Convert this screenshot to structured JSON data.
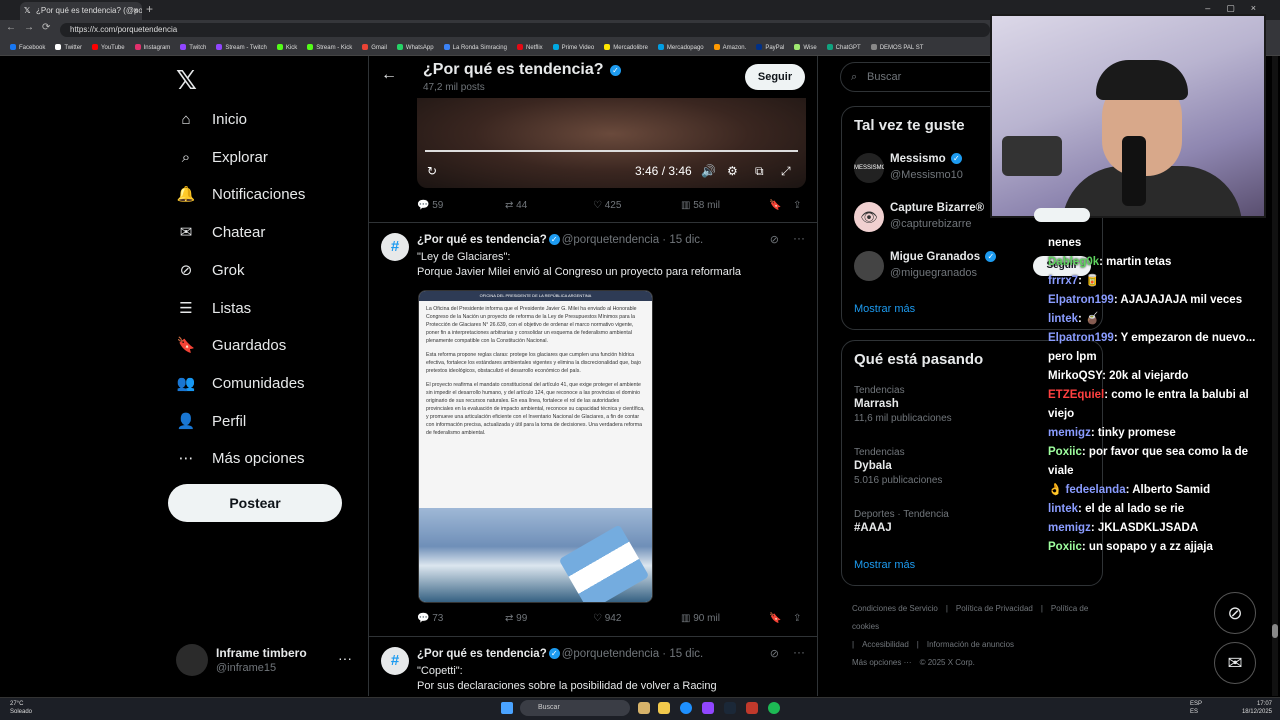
{
  "browser": {
    "tab_title": "¿Por qué es tendencia? (@porque",
    "url": "https://x.com/porquetendencia",
    "bookmarks": [
      {
        "label": "Facebook",
        "color": "#1877f2"
      },
      {
        "label": "Twitter",
        "color": "#ffffff"
      },
      {
        "label": "YouTube",
        "color": "#ff0000"
      },
      {
        "label": "Instagram",
        "color": "#e1306c"
      },
      {
        "label": "Twitch",
        "color": "#9146ff"
      },
      {
        "label": "Stream - Twitch",
        "color": "#9146ff"
      },
      {
        "label": "Kick",
        "color": "#53fc18"
      },
      {
        "label": "Stream - Kick",
        "color": "#53fc18"
      },
      {
        "label": "Gmail",
        "color": "#ea4335"
      },
      {
        "label": "WhatsApp",
        "color": "#25d366"
      },
      {
        "label": "La Ronda Simracing",
        "color": "#3b82f6"
      },
      {
        "label": "Netflix",
        "color": "#e50914"
      },
      {
        "label": "Prime Video",
        "color": "#00a8e1"
      },
      {
        "label": "Mercadolibre",
        "color": "#ffe600"
      },
      {
        "label": "Mercadopago",
        "color": "#009ee3"
      },
      {
        "label": "Amazon.",
        "color": "#ff9900"
      },
      {
        "label": "PayPal",
        "color": "#003087"
      },
      {
        "label": "Wise",
        "color": "#9fe870"
      },
      {
        "label": "ChatGPT",
        "color": "#10a37f"
      },
      {
        "label": "DEMOS PAL ST",
        "color": "#888888"
      }
    ]
  },
  "nav": {
    "logo": "𝕏",
    "items": [
      {
        "label": "Inicio",
        "icon": "home-icon",
        "glyph": "⌂"
      },
      {
        "label": "Explorar",
        "icon": "search-icon",
        "glyph": "⌕"
      },
      {
        "label": "Notificaciones",
        "icon": "bell-icon",
        "glyph": "🔔"
      },
      {
        "label": "Chatear",
        "icon": "mail-icon",
        "glyph": "✉"
      },
      {
        "label": "Grok",
        "icon": "grok-icon",
        "glyph": "⊘"
      },
      {
        "label": "Listas",
        "icon": "list-icon",
        "glyph": "☰"
      },
      {
        "label": "Guardados",
        "icon": "bookmark-icon",
        "glyph": "🔖"
      },
      {
        "label": "Comunidades",
        "icon": "communities-icon",
        "glyph": "👥"
      },
      {
        "label": "Perfil",
        "icon": "profile-icon",
        "glyph": "👤"
      },
      {
        "label": "Más opciones",
        "icon": "more-icon",
        "glyph": "⋯"
      }
    ],
    "post_label": "Postear",
    "account": {
      "name": "Inframe timbero",
      "handle": "@inframe15"
    }
  },
  "profile_header": {
    "title": "¿Por qué es tendencia?",
    "posts": "47,2 mil posts",
    "follow_label": "Seguir"
  },
  "video": {
    "time": "3:46 / 3:46"
  },
  "tweet0_metrics": {
    "replies": "59",
    "reposts": "44",
    "likes": "425",
    "views": "58 mil"
  },
  "tweets": [
    {
      "name": "¿Por qué es tendencia?",
      "handle": "@porquetendencia",
      "date": "· 15 dic.",
      "line1": "\"Ley de Glaciares\":",
      "line2": "Porque Javier Milei envió al Congreso un proyecto para reformarla",
      "metrics": {
        "replies": "73",
        "reposts": "99",
        "likes": "942",
        "views": "90 mil"
      }
    },
    {
      "name": "¿Por qué es tendencia?",
      "handle": "@porquetendencia",
      "date": "· 15 dic.",
      "line1": "\"Copetti\":",
      "line2": "Por sus declaraciones sobre la posibilidad de volver a Racing"
    }
  ],
  "doc_image": {
    "header": "OFICINA DEL PRESIDENTE DE LA REPÚBLICA ARGENTINA",
    "p1": "La Oficina del Presidente informa que el Presidente Javier G. Milei ha enviado al Honorable Congreso de la Nación un proyecto de reforma de la Ley de Presupuestos Mínimos para la Protección de Glaciares N° 26.639, con el objetivo de ordenar el marco normativo vigente, poner fin a interpretaciones arbitrarias y consolidar un esquema de federalismo ambiental plenamente compatible con la Constitución Nacional.",
    "p2": "Esta reforma propone reglas claras: protege los glaciares que cumplen una función hídrica efectiva, fortalece los estándares ambientales vigentes y elimina la discrecionalidad que, bajo pretextos ideológicos, obstaculizó el desarrollo económico del país.",
    "p3": "El proyecto reafirma el mandato constitucional del artículo 41, que exige proteger el ambiente sin impedir el desarrollo humano, y del artículo 124, que reconoce a las provincias el dominio originario de sus recursos naturales. En esa línea, fortalece el rol de las autoridades provinciales en la evaluación de impacto ambiental, reconoce su capacidad técnica y científica, y promueve una articulación eficiente con el Inventario Nacional de Glaciares, a fin de contar con información precisa, actualizada y útil para la toma de decisiones. Una verdadera reforma de federalismo ambiental."
  },
  "right": {
    "search_placeholder": "Buscar",
    "suggest_title": "Tal vez te guste",
    "suggestions": [
      {
        "name": "Messismo",
        "handle": "@Messismo10",
        "avatar": "MESSISMO"
      },
      {
        "name": "Capture Bizarre®",
        "handle": "@capturebizarre",
        "avatar": "👁"
      },
      {
        "name": "Migue Granados",
        "handle": "@miguegranados",
        "avatar": ""
      }
    ],
    "show_more": "Mostrar más",
    "trends_title": "Qué está pasando",
    "trends": [
      {
        "cat": "Tendencias",
        "topic": "Marrash",
        "count": "11,6 mil publicaciones"
      },
      {
        "cat": "Tendencias",
        "topic": "Dybala",
        "count": "5.016 publicaciones"
      },
      {
        "cat": "Deportes · Tendencia",
        "topic": "#AAAJ",
        "count": ""
      }
    ],
    "show_more2": "Mostrar más",
    "footer": [
      "Condiciones de Servicio",
      "|",
      "Política de Privacidad",
      "|",
      "Política de cookies",
      "|",
      "Accesibilidad",
      "|",
      "Información de anuncios",
      "Más opciones ···",
      "© 2025 X Corp."
    ]
  },
  "chat": {
    "seguir_label": "Seguir",
    "messages": [
      {
        "user": "",
        "msg": "nenes",
        "color": "#ffffff"
      },
      {
        "user": "Dableg0k",
        "msg": ": martin tetas",
        "color": "#5fd35f"
      },
      {
        "user": "frrrx7",
        "msg": ": 🥫",
        "color": "#8a9cff"
      },
      {
        "user": "Elpatron199",
        "msg": ": AJAJAJAJA mil veces",
        "color": "#8a9cff"
      },
      {
        "user": "lintek",
        "msg": ": 🧉",
        "color": "#8a9cff"
      },
      {
        "user": "Elpatron199",
        "msg": ": Y empezaron de nuevo... pero lpm",
        "color": "#8a9cff"
      },
      {
        "user": "MirkoQSY",
        "msg": ": 20k al viejardo",
        "color": "#ffffff"
      },
      {
        "user": "ETZEquiel",
        "msg": ": como le entra la balubi al viejo",
        "color": "#ff4040"
      },
      {
        "user": "memigz",
        "msg": ": tinky promese",
        "color": "#8a9cff"
      },
      {
        "user": "Poxiic",
        "msg": ": por favor que sea como la de viale",
        "color": "#9fff9f"
      },
      {
        "user": "👌 fedeelanda",
        "msg": ": Alberto Samid",
        "color": "#8a9cff"
      },
      {
        "user": "lintek",
        "msg": ": el de al lado se rie",
        "color": "#8a9cff"
      },
      {
        "user": "memigz",
        "msg": ": JKLASDKLJSADA",
        "color": "#8a9cff"
      },
      {
        "user": "Poxiic",
        "msg": ": un sopapo y a zz ajjaja",
        "color": "#9fff9f"
      }
    ]
  },
  "taskbar": {
    "temp": "27°C",
    "weather": "Soleado",
    "search": "Buscar",
    "lang1": "ESP",
    "lang2": "ES",
    "time": "17:07",
    "date": "18/12/2025"
  }
}
